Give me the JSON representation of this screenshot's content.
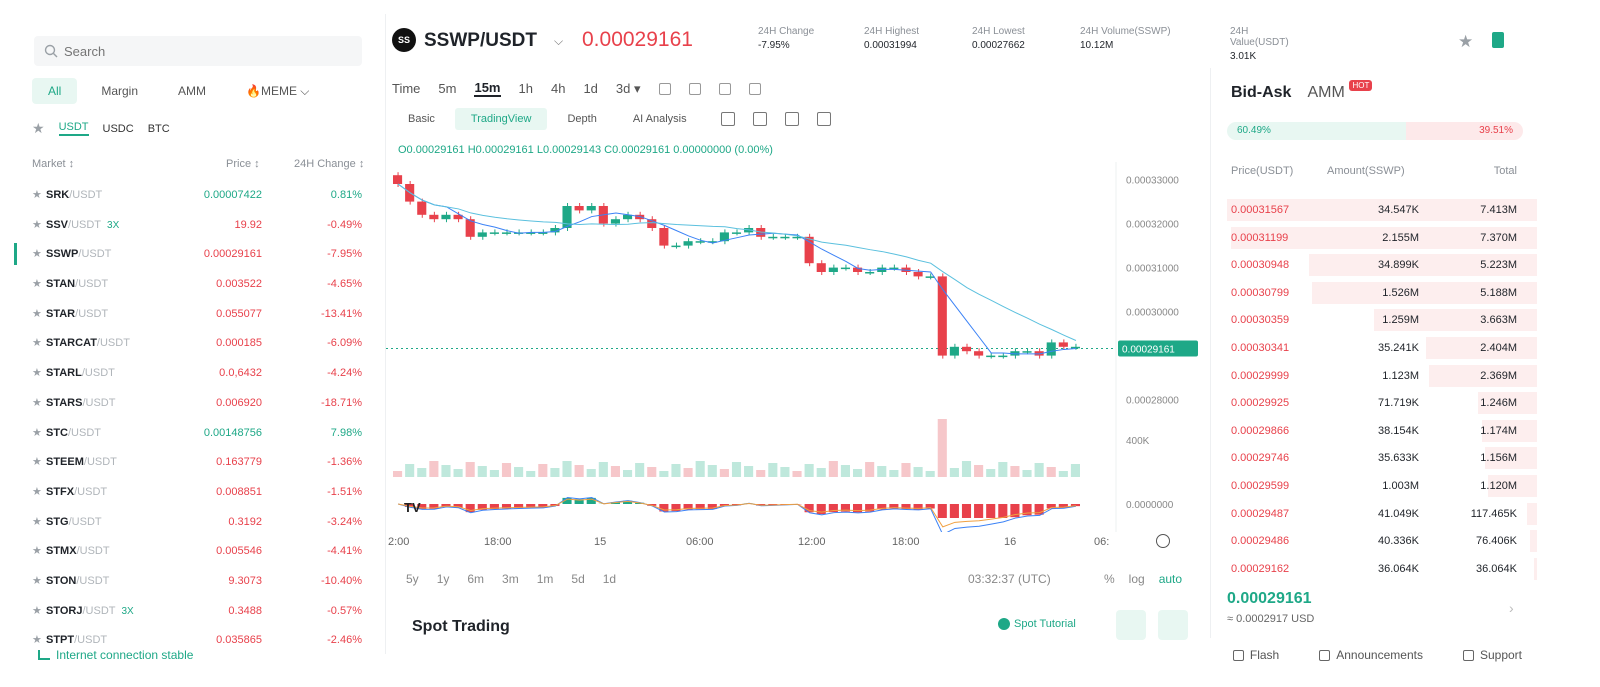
{
  "search": {
    "placeholder": "Search"
  },
  "market_tabs": [
    "All",
    "Margin",
    "AMM",
    "🔥MEME ⌵"
  ],
  "quote_tabs": [
    "USDT",
    "USDC",
    "BTC"
  ],
  "market_header": {
    "market": "Market ↕",
    "price": "Price ↕",
    "change": "24H Change ↕"
  },
  "markets": [
    {
      "base": "SRK",
      "quote": "/USDT",
      "lev": "",
      "price": "0.00007422",
      "change": "0.81%",
      "dir": "up"
    },
    {
      "base": "SSV",
      "quote": "/USDT",
      "lev": "3X",
      "price": "19.92",
      "change": "-0.49%",
      "dir": "dn"
    },
    {
      "base": "SSWP",
      "quote": "/USDT",
      "lev": "",
      "price": "0.00029161",
      "change": "-7.95%",
      "dir": "dn"
    },
    {
      "base": "STAN",
      "quote": "/USDT",
      "lev": "",
      "price": "0.003522",
      "change": "-4.65%",
      "dir": "dn"
    },
    {
      "base": "STAR",
      "quote": "/USDT",
      "lev": "",
      "price": "0.055077",
      "change": "-13.41%",
      "dir": "dn"
    },
    {
      "base": "STARCAT",
      "quote": "/USDT",
      "lev": "",
      "price": "0.000185",
      "change": "-6.09%",
      "dir": "dn"
    },
    {
      "base": "STARL",
      "quote": "/USDT",
      "lev": "",
      "price": "0.0,6432",
      "change": "-4.24%",
      "dir": "dn"
    },
    {
      "base": "STARS",
      "quote": "/USDT",
      "lev": "",
      "price": "0.006920",
      "change": "-18.71%",
      "dir": "dn"
    },
    {
      "base": "STC",
      "quote": "/USDT",
      "lev": "",
      "price": "0.00148756",
      "change": "7.98%",
      "dir": "up"
    },
    {
      "base": "STEEM",
      "quote": "/USDT",
      "lev": "",
      "price": "0.163779",
      "change": "-1.36%",
      "dir": "dn"
    },
    {
      "base": "STFX",
      "quote": "/USDT",
      "lev": "",
      "price": "0.008851",
      "change": "-1.51%",
      "dir": "dn"
    },
    {
      "base": "STG",
      "quote": "/USDT",
      "lev": "",
      "price": "0.3192",
      "change": "-3.24%",
      "dir": "dn"
    },
    {
      "base": "STMX",
      "quote": "/USDT",
      "lev": "",
      "price": "0.005546",
      "change": "-4.41%",
      "dir": "dn"
    },
    {
      "base": "STON",
      "quote": "/USDT",
      "lev": "",
      "price": "9.3073",
      "change": "-10.40%",
      "dir": "dn"
    },
    {
      "base": "STORJ",
      "quote": "/USDT",
      "lev": "3X",
      "price": "0.3488",
      "change": "-0.57%",
      "dir": "dn"
    },
    {
      "base": "STPT",
      "quote": "/USDT",
      "lev": "",
      "price": "0.035865",
      "change": "-2.46%",
      "dir": "dn"
    }
  ],
  "ticker": {
    "logo": "SS",
    "symbol": "SSWP/USDT",
    "last_price": "0.00029161",
    "stats": [
      {
        "label": "24H Change",
        "value": "-7.95%",
        "dir": "dn"
      },
      {
        "label": "24H Highest",
        "value": "0.00031994",
        "dir": ""
      },
      {
        "label": "24H Lowest",
        "value": "0.00027662",
        "dir": ""
      },
      {
        "label": "24H Volume(SSWP)",
        "value": "10.12M",
        "dir": ""
      },
      {
        "label": "24H Value(USDT)",
        "value": "3.01K",
        "dir": ""
      }
    ]
  },
  "timeframes": [
    "Time",
    "5m",
    "15m",
    "1h",
    "4h",
    "1d",
    "3d ▾"
  ],
  "view_tabs": [
    "Basic",
    "TradingView",
    "Depth",
    "AI Analysis"
  ],
  "ohlc_line": "O0.00029161 H0.00029161 L0.00029143 C0.00029161 0.00000000 (0.00%)",
  "price_axis": [
    "0.00033000",
    "0.00032000",
    "0.00031000",
    "0.00030000",
    "0.00029161",
    "0.00028000"
  ],
  "volume_axis": "400K",
  "macd_axis": "0.0000000",
  "x_axis": [
    "2:00",
    "18:00",
    "15",
    "06:00",
    "12:00",
    "18:00",
    "16",
    "06:"
  ],
  "ranges": [
    "5y",
    "1y",
    "6m",
    "3m",
    "1m",
    "5d",
    "1d"
  ],
  "clock": "03:32:37 (UTC)",
  "scales": [
    "%",
    "log",
    "auto"
  ],
  "spot_trading": "Spot Trading",
  "spot_tutorial": "Spot Tutorial",
  "orderbook": {
    "tabs": {
      "bid_ask": "Bid-Ask",
      "amm": "AMM",
      "hot": "HOT"
    },
    "buy_ratio": "60.49%",
    "sell_ratio": "39.51%",
    "headers": {
      "price": "Price(USDT)",
      "amount": "Amount(SSWP)",
      "total": "Total"
    },
    "asks": [
      {
        "price": "0.00031567",
        "amount": "34.547K",
        "total": "7.413M",
        "depth": 0.95
      },
      {
        "price": "0.00031199",
        "amount": "2.155M",
        "total": "7.370M",
        "depth": 0.94
      },
      {
        "price": "0.00030948",
        "amount": "34.899K",
        "total": "5.223M",
        "depth": 0.7
      },
      {
        "price": "0.00030799",
        "amount": "1.526M",
        "total": "5.188M",
        "depth": 0.69
      },
      {
        "price": "0.00030359",
        "amount": "1.259M",
        "total": "3.663M",
        "depth": 0.5
      },
      {
        "price": "0.00030341",
        "amount": "35.241K",
        "total": "2.404M",
        "depth": 0.34
      },
      {
        "price": "0.00029999",
        "amount": "1.123M",
        "total": "2.369M",
        "depth": 0.33
      },
      {
        "price": "0.00029925",
        "amount": "71.719K",
        "total": "1.246M",
        "depth": 0.18
      },
      {
        "price": "0.00029866",
        "amount": "38.154K",
        "total": "1.174M",
        "depth": 0.17
      },
      {
        "price": "0.00029746",
        "amount": "35.633K",
        "total": "1.156M",
        "depth": 0.16
      },
      {
        "price": "0.00029599",
        "amount": "1.003M",
        "total": "1.120M",
        "depth": 0.15
      },
      {
        "price": "0.00029487",
        "amount": "41.049K",
        "total": "117.465K",
        "depth": 0.03
      },
      {
        "price": "0.00029486",
        "amount": "40.336K",
        "total": "76.406K",
        "depth": 0.02
      },
      {
        "price": "0.00029162",
        "amount": "36.064K",
        "total": "36.064K",
        "depth": 0.01
      }
    ],
    "last_price": "0.00029161",
    "last_usd": "≈ 0.0002917 USD"
  },
  "footer": {
    "connection": "Internet connection stable",
    "links": [
      "Flash",
      "Announcements",
      "Support"
    ]
  },
  "colors": {
    "up": "#1ea887",
    "down": "#e8414b",
    "ma1": "#5bc0de",
    "ma2": "#3b82f6",
    "signal": "#f0a040"
  },
  "chart_data": {
    "type": "candlestick",
    "title": "SSWP/USDT 15m",
    "close": [
      0.000329,
      0.000325,
      0.000322,
      0.000321,
      0.000322,
      0.000321,
      0.000317,
      0.000318,
      0.000318,
      0.000318,
      0.000318,
      0.000318,
      0.000318,
      0.000319,
      0.000324,
      0.000323,
      0.000324,
      0.00032,
      0.000321,
      0.000322,
      0.000321,
      0.000319,
      0.000315,
      0.000315,
      0.000316,
      0.000316,
      0.000316,
      0.000318,
      0.000318,
      0.000319,
      0.000317,
      0.000317,
      0.000317,
      0.000317,
      0.000311,
      0.000309,
      0.00031,
      0.00031,
      0.000309,
      0.000309,
      0.00031,
      0.00031,
      0.000309,
      0.000308,
      0.000308,
      0.00029,
      0.000292,
      0.000291,
      0.00029,
      0.00029,
      0.00029,
      0.000291,
      0.000291,
      0.00029,
      0.000293,
      0.000292,
      0.000292
    ],
    "ylim": [
      0.000284,
      0.000334
    ]
  }
}
